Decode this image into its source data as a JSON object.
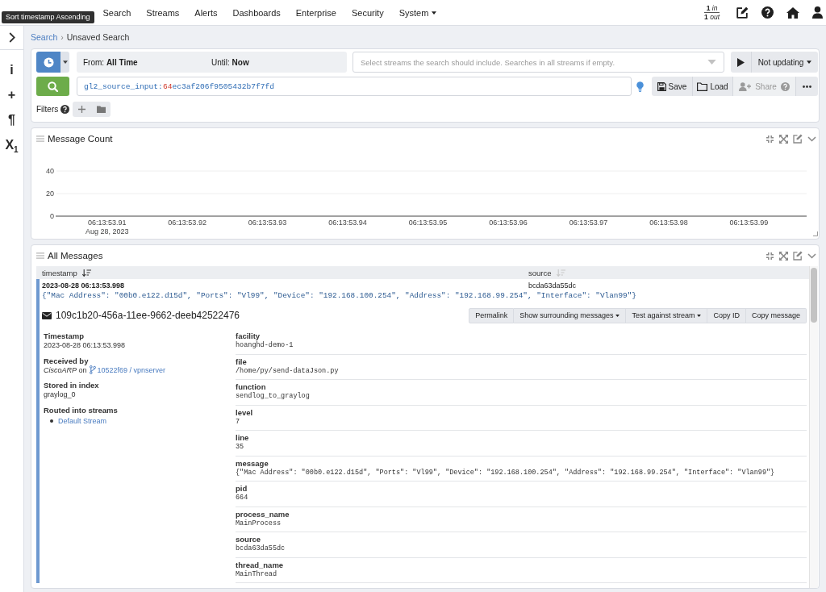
{
  "tooltip": {
    "text": "Sort timestamp Ascending"
  },
  "nav": {
    "items": [
      {
        "label": "Search",
        "dropdown": false
      },
      {
        "label": "Streams",
        "dropdown": false
      },
      {
        "label": "Alerts",
        "dropdown": false
      },
      {
        "label": "Dashboards",
        "dropdown": false
      },
      {
        "label": "Enterprise",
        "dropdown": false
      },
      {
        "label": "Security",
        "dropdown": false
      },
      {
        "label": "System",
        "dropdown": true
      }
    ],
    "throughput": {
      "in_count": "1",
      "in_label": "in",
      "out_count": "1",
      "out_label": "out"
    }
  },
  "sidebar": {
    "items": [
      {
        "glyph": "i"
      },
      {
        "glyph": "+"
      },
      {
        "glyph": "¶"
      },
      {
        "glyph": "X$_{1}$"
      }
    ]
  },
  "breadcrumb": {
    "separator": "›",
    "items": [
      {
        "label": "Search",
        "kind": "link"
      },
      {
        "label": "Unsaved Search",
        "kind": "current"
      }
    ]
  },
  "search_bar": {
    "time_range": {
      "from": "From: **All Time**",
      "until": "Until: **Now**"
    },
    "streams": {
      "placeholder": "Select streams the search should include. Searches in all streams if empty."
    },
    "refresh": {
      "label": "Not updating"
    },
    "query": {
      "parts": [
        {
          "kind": "field",
          "text": "gl2_source_input:"
        },
        {
          "kind": "number",
          "text": "64"
        },
        {
          "kind": "term",
          "text": "ec3af206f9505432b7f7fd"
        }
      ]
    },
    "actions": [
      {
        "kind": "save",
        "label": "Save",
        "disabled": false
      },
      {
        "kind": "load",
        "label": "Load",
        "disabled": false
      },
      {
        "kind": "share",
        "label": "Share",
        "disabled": true
      }
    ],
    "filters": {
      "label": "Filters"
    }
  },
  "message_count": {
    "title": "Message Count",
    "chart_data": {
      "type": "bar",
      "categories": [
        "06:13:53.91",
        "06:13:53.92",
        "06:13:53.93",
        "06:13:53.94",
        "06:13:53.95",
        "06:13:53.96",
        "06:13:53.97",
        "06:13:53.98",
        "06:13:53.99"
      ],
      "ylim": [
        0,
        40
      ],
      "yticks": [
        0,
        20,
        40
      ],
      "annotations": [
        "Aug 28, 2023"
      ]
    }
  },
  "all_messages": {
    "title": "All Messages",
    "columns": [
      {
        "label": "timestamp",
        "sorted": true
      },
      {
        "label": "source",
        "sorted": false
      }
    ],
    "rows": [
      {
        "timestamp": "2023-08-28 06:13:53.998",
        "source": "bcda63da55dc",
        "message": "{\"Mac Address\": \"00b0.e122.d15d\", \"Ports\": \"Vl99\", \"Device\": \"192.168.100.254\", \"Address\": \"192.168.99.254\", \"Interface\": \"Vlan99\"}",
        "expanded": true,
        "detail": {
          "id": "109c1b20-456a-11ee-9662-deeb42522476",
          "buttons": [
            {
              "label": "Permalink",
              "dropdown": false
            },
            {
              "label": "Show surrounding messages",
              "dropdown": true
            },
            {
              "label": "Test against stream",
              "dropdown": true
            },
            {
              "label": "Copy ID",
              "dropdown": false
            },
            {
              "label": "Copy message",
              "dropdown": false
            }
          ],
          "meta": [
            {
              "kind": "text",
              "label": "Timestamp",
              "value": "2023-08-28 06:13:53.998"
            },
            {
              "kind": "received",
              "label": "Received by",
              "input": "CiscoARP",
              "connector": "on",
              "node": "10522f69 / vpnserver"
            },
            {
              "kind": "text",
              "label": "Stored in index",
              "value": "graylog_0"
            },
            {
              "kind": "list",
              "label": "Routed into streams",
              "items": [
                "Default Stream"
              ]
            }
          ],
          "fields": [
            {
              "name": "facility",
              "value": "hoanghd-demo-1"
            },
            {
              "name": "file",
              "value": "/home/py/send-dataJson.py"
            },
            {
              "name": "function",
              "value": "sendlog_to_graylog"
            },
            {
              "name": "level",
              "value": "7"
            },
            {
              "name": "line",
              "value": "35"
            },
            {
              "name": "message",
              "value": "{\"Mac Address\": \"00b0.e122.d15d\", \"Ports\": \"Vl99\", \"Device\": \"192.168.100.254\", \"Address\": \"192.168.99.254\", \"Interface\": \"Vlan99\"}"
            },
            {
              "name": "pid",
              "value": "664"
            },
            {
              "name": "process_name",
              "value": "MainProcess"
            },
            {
              "name": "source",
              "value": "bcda63da55dc"
            },
            {
              "name": "thread_name",
              "value": "MainThread"
            }
          ]
        }
      }
    ]
  }
}
